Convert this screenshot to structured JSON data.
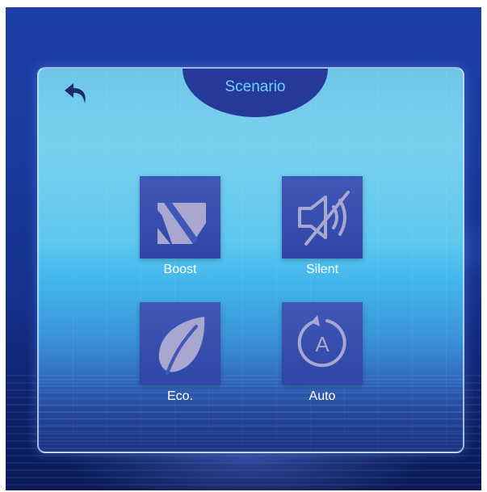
{
  "header": {
    "title": "Scenario"
  },
  "back": {
    "icon": "back-arrow-icon"
  },
  "modes": [
    {
      "label": "Boost",
      "icon": "boost-icon"
    },
    {
      "label": "Silent",
      "icon": "mute-speaker-icon"
    },
    {
      "label": "Eco.",
      "icon": "leaf-icon"
    },
    {
      "label": "Auto",
      "icon": "auto-cycle-icon"
    }
  ],
  "colors": {
    "tile": "#3349ad",
    "icon": "#a9a6cf",
    "title_text": "#6fd0ff",
    "title_tab": "#25399a"
  }
}
